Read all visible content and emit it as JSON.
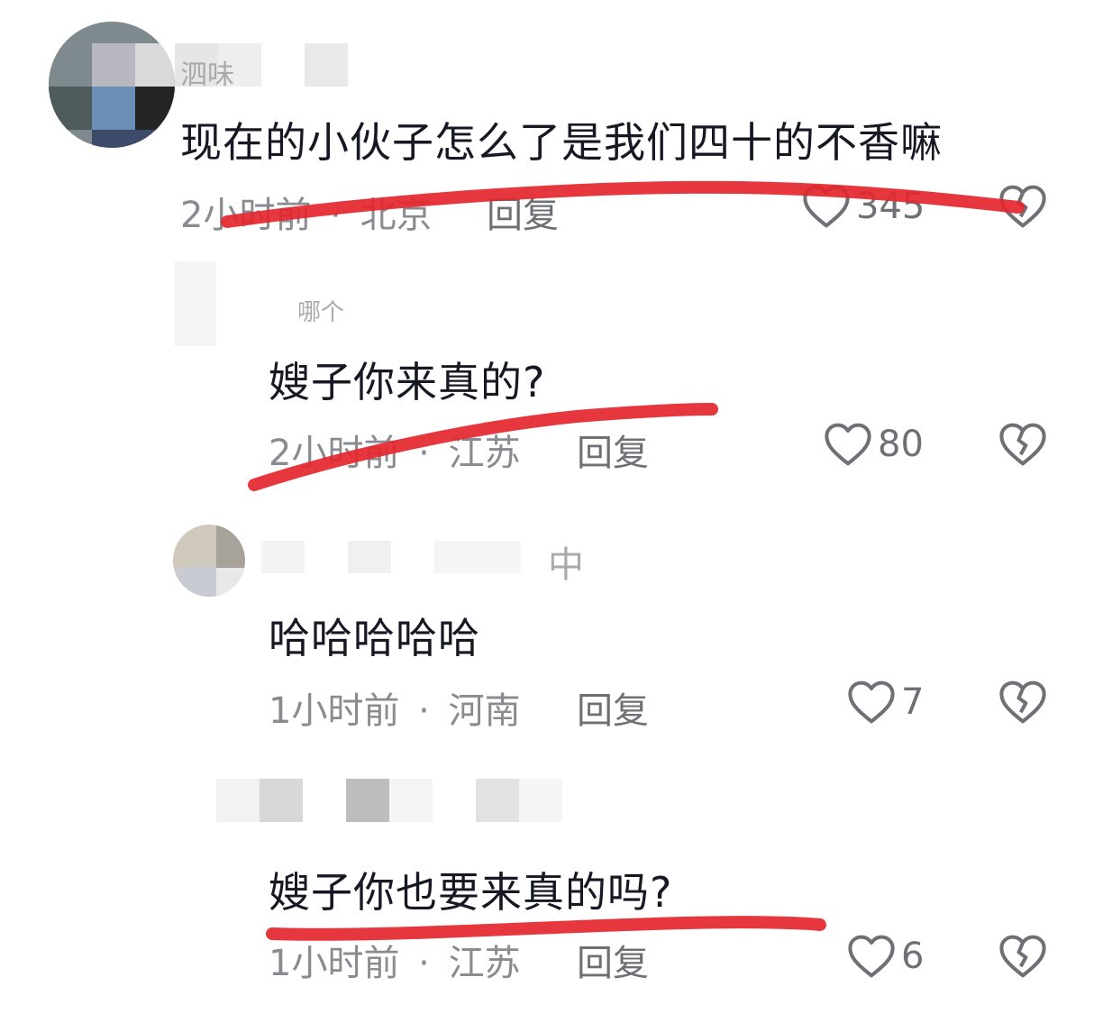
{
  "comments": [
    {
      "username": "泗味",
      "text": "现在的小伙子怎么了是我们四十的不香嘛",
      "time": "2小时前",
      "location": "北京",
      "reply_label": "回复",
      "likes": "345"
    },
    {
      "username": "哪个",
      "text": "嫂子你来真的?",
      "time": "2小时前",
      "location": "江苏",
      "reply_label": "回复",
      "likes": "80"
    },
    {
      "username": "中",
      "text": "哈哈哈哈哈",
      "time": "1小时前",
      "location": "河南",
      "reply_label": "回复",
      "likes": "7"
    },
    {
      "username": "",
      "text": "嫂子你也要来真的吗?",
      "time": "1小时前",
      "location": "江苏",
      "reply_label": "回复",
      "likes": "6"
    }
  ],
  "separator": "·",
  "colors": {
    "annotation_stroke": "#e3262c",
    "meta_text": "#8a8b91",
    "primary_text": "#161823"
  },
  "icons": {
    "like": "heart-outline-icon",
    "dislike": "broken-heart-icon"
  }
}
